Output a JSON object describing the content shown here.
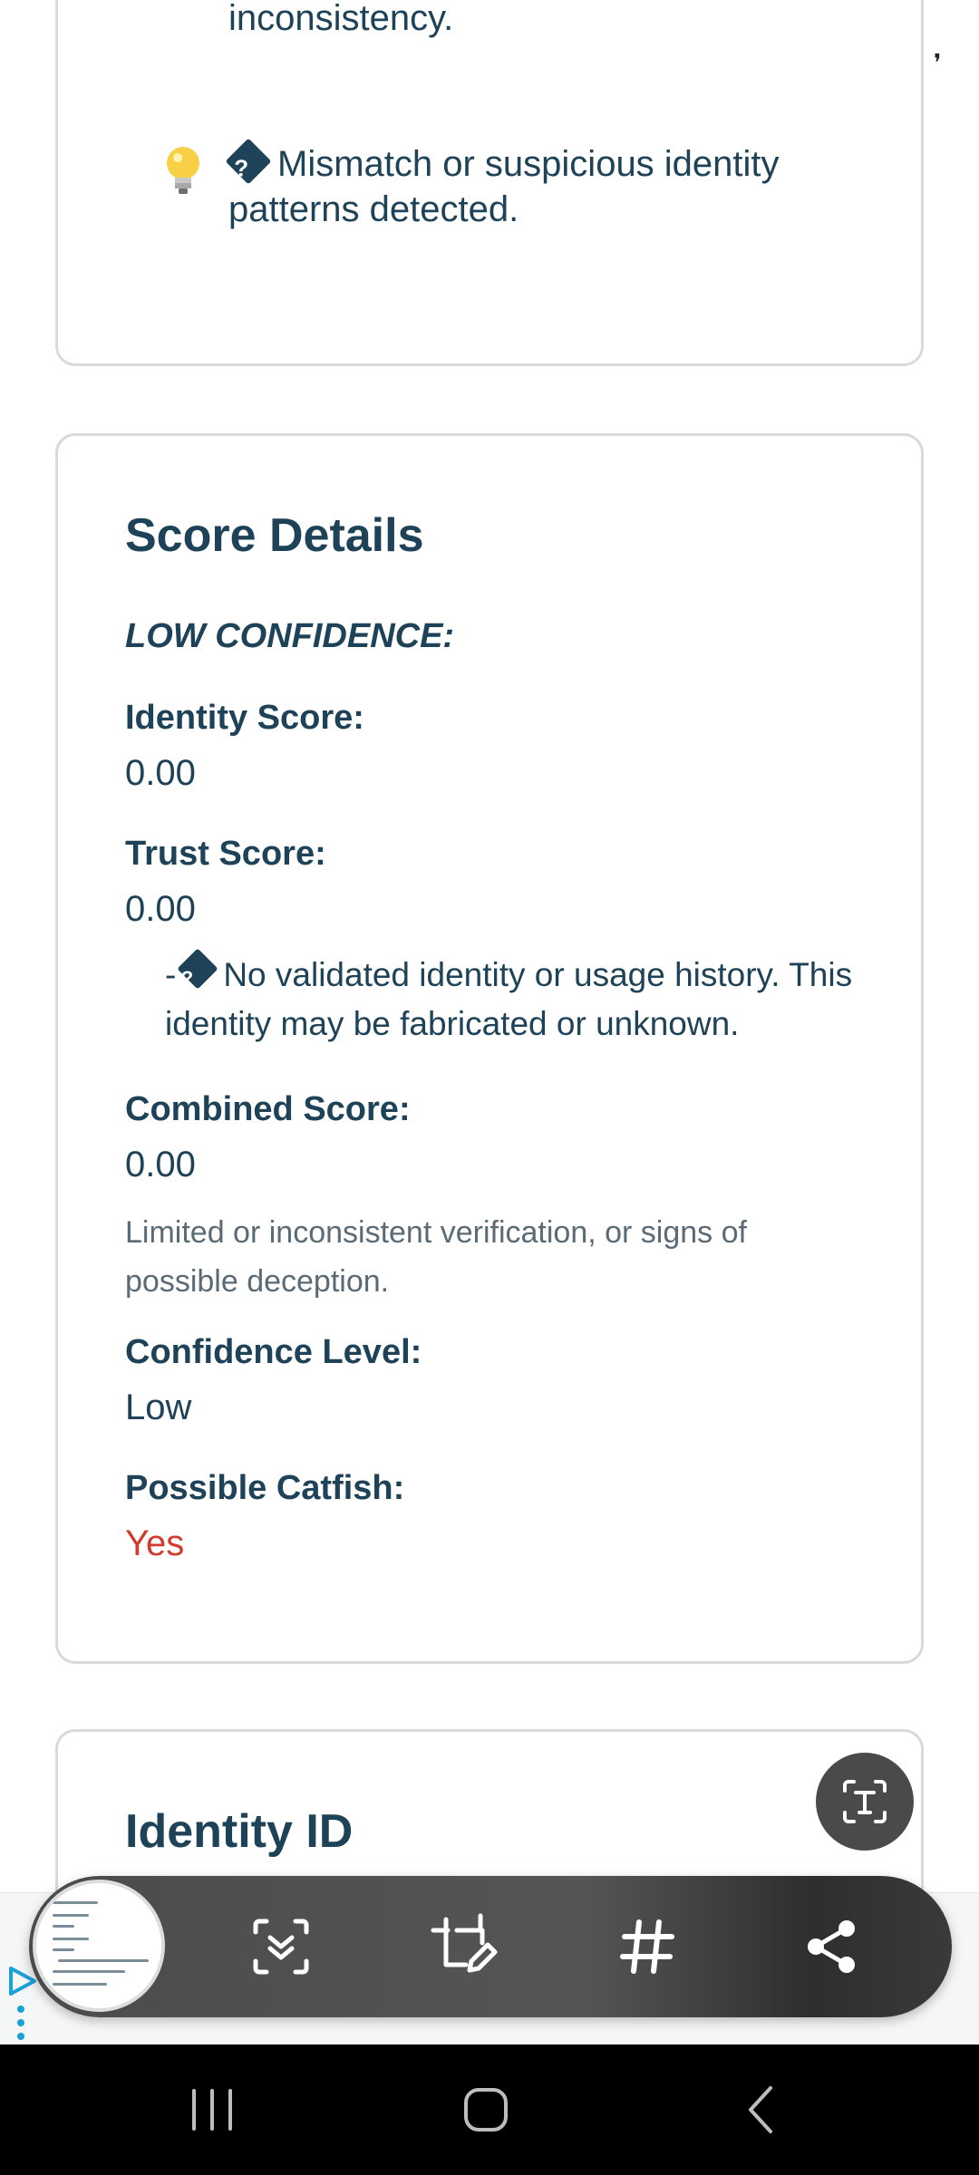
{
  "top_card": {
    "partial_line": "inconsistency.",
    "insight_text": "Mismatch or suspicious identity patterns detected.",
    "insight_glyph": "?"
  },
  "score_details": {
    "title": "Score Details",
    "confidence_heading": "LOW CONFIDENCE:",
    "identity_label": "Identity Score:",
    "identity_value": "0.00",
    "trust_label": "Trust Score:",
    "trust_value": "0.00",
    "trust_note_prefix": "-",
    "trust_note_glyph": "?",
    "trust_note": "No validated identity or usage history. This identity may be fabricated or unknown.",
    "combined_label": "Combined Score:",
    "combined_value": "0.00",
    "combined_desc": "Limited or inconsistent verification, or signs of possible deception.",
    "confidence_label": "Confidence Level:",
    "confidence_value": "Low",
    "catfish_label": "Possible Catfish:",
    "catfish_value": "Yes"
  },
  "identity_card": {
    "title": "Identity ID"
  },
  "colors": {
    "text": "#1e4257",
    "alert": "#d23a2f",
    "toolbar": "#4b4b4b"
  },
  "toolbar": {
    "icons": [
      "ocr-icon",
      "scroll-capture-icon",
      "crop-draw-icon",
      "hashtag-icon",
      "share-icon"
    ]
  },
  "status_bar": {
    "mark": "❜"
  }
}
